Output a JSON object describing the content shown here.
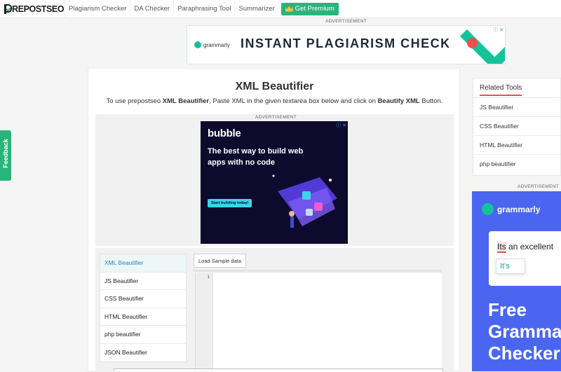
{
  "nav": {
    "logo": "REPOSTSEO",
    "links": [
      "Plagiarism Checker",
      "DA Checker",
      "Paraphrasing Tool",
      "Summarizer"
    ],
    "premium": "Get Premium"
  },
  "top_ad": {
    "label": "ADVERTISEMENT",
    "brand": "grammarly",
    "headline": "INSTANT PLAGIARISM CHECK"
  },
  "main": {
    "title": "XML Beautifier",
    "intro_prefix": "To use prepostseo ",
    "intro_tool": "XML Beautifier",
    "intro_mid": ", Paste XML in the given textarea box below and click on ",
    "intro_button": "Beautify XML",
    "intro_suffix": " Button."
  },
  "mid_ad": {
    "label": "ADVERTISEMENT",
    "brand": "bubble",
    "headline": "The best way to build web apps with no code",
    "cta": "Start building today!"
  },
  "tool": {
    "menu": [
      "XML Beautifier",
      "JS Beautifier",
      "CSS Beautifier",
      "HTML Beautifier",
      "php beautifier",
      "JSON Beautifier"
    ],
    "active_index": 0,
    "sample_button": "Load Sample data",
    "line_number": "1"
  },
  "related": {
    "title": "Related Tools",
    "items": [
      "JS Beautifier",
      "CSS Beautifier",
      "HTML Beautifier",
      "php beautifier"
    ]
  },
  "side_ad": {
    "label": "ADVERTISEMENT",
    "brand": "grammarly",
    "its": "Its",
    "rest": " an excellent",
    "suggestion": "It's",
    "big": "Free Grammar Checker"
  },
  "feedback": "Feedback",
  "colors": {
    "brand_green": "#29b47b",
    "grammarly_green": "#15c39a",
    "grammarly_blue": "#4a66f0",
    "bubble_navy": "#0d0a2d"
  }
}
